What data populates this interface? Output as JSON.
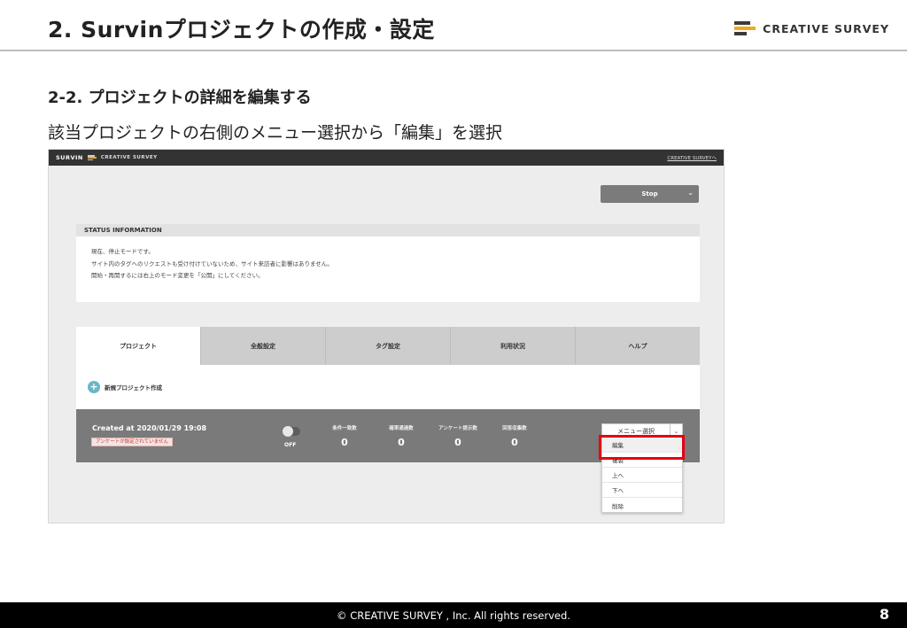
{
  "slide": {
    "title": "2.  Survinプロジェクトの作成・設定",
    "brand_text": "CREATIVE SURVEY",
    "section_heading": "2-2. プロジェクトの詳細を編集する",
    "instruction": "該当プロジェクトの右側のメニュー選択から「編集」を選択",
    "footer": "© CREATIVE SURVEY , Inc.  All rights reserved.",
    "page_number": "8"
  },
  "app": {
    "topbar": {
      "logo_text": "SURVIN",
      "logo_brand": "CREATIVE SURVEY",
      "link": "CREATIVE SURVEYへ"
    },
    "mode_button": {
      "label": "Stop"
    },
    "status": {
      "heading": "STATUS INFORMATION",
      "lines": [
        "現在、停止モードです。",
        "サイト内のタグへのリクエストも受け付けていないため、サイト来訪者に影響はありません。",
        "開始・再開するには右上のモード変更を「公開」にしてください。"
      ]
    },
    "tabs": [
      {
        "label": "プロジェクト",
        "active": true
      },
      {
        "label": "全般設定",
        "active": false
      },
      {
        "label": "タグ設定",
        "active": false
      },
      {
        "label": "利用状況",
        "active": false
      },
      {
        "label": "ヘルプ",
        "active": false
      }
    ],
    "new_project_label": "新規プロジェクト作成",
    "project": {
      "created": "Created at 2020/01/29 19:08",
      "warning": "アンケートが設定されていません",
      "toggle_label": "OFF",
      "stats": [
        {
          "label": "条件一致数",
          "value": "0"
        },
        {
          "label": "確率通過数",
          "value": "0"
        },
        {
          "label": "アンケート提示数",
          "value": "0"
        },
        {
          "label": "回答収集数",
          "value": "0"
        }
      ],
      "menu_select_label": "メニュー選択"
    },
    "dropdown_items": [
      "編集",
      "複製",
      "上へ",
      "下へ",
      "削除"
    ]
  },
  "colors": {
    "highlight": "#e60012",
    "accent": "#f0a91e",
    "topbar": "#333333",
    "project_row": "#7a7a7a"
  }
}
